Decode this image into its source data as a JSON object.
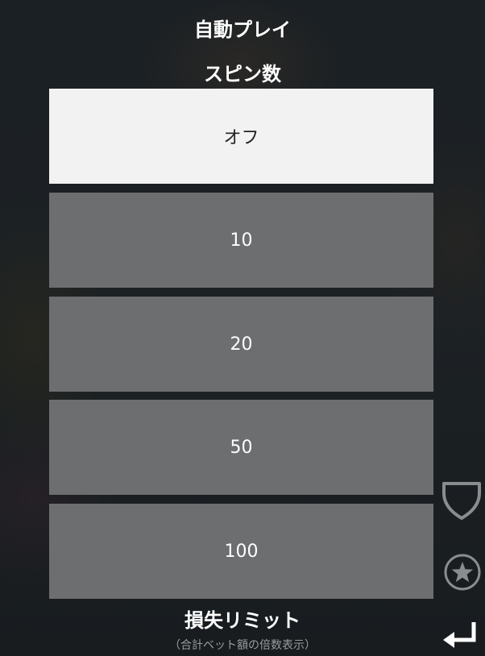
{
  "header": {
    "title": "自動プレイ",
    "spins_label": "スピン数"
  },
  "spin_options": [
    {
      "label": "オフ",
      "selected": true
    },
    {
      "label": "10",
      "selected": false
    },
    {
      "label": "20",
      "selected": false
    },
    {
      "label": "50",
      "selected": false
    },
    {
      "label": "100",
      "selected": false
    }
  ],
  "loss_limit": {
    "label": "損失リミット",
    "note": "（合計ベット額の倍数表示）"
  },
  "icons": {
    "shield": "shield-icon",
    "star": "star-icon",
    "enter": "return-arrow-icon"
  },
  "colors": {
    "selected_bg": "#f2f2f2",
    "option_bg": "#6d6e6f",
    "icon_gray": "#8a8c8e"
  }
}
